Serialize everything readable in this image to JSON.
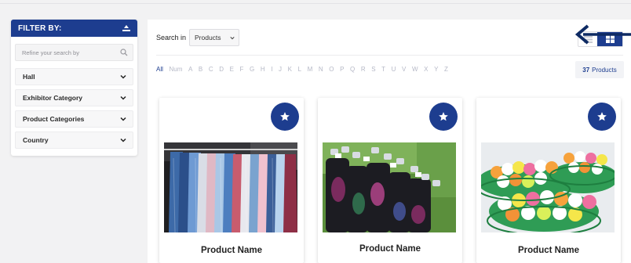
{
  "filter": {
    "title": "FILTER BY:",
    "search_placeholder": "Refine your search by",
    "dropdowns": [
      {
        "label": "Hall"
      },
      {
        "label": "Exhibitor Category"
      },
      {
        "label": "Product Categories"
      },
      {
        "label": "Country"
      }
    ]
  },
  "toolbar": {
    "search_in_label": "Search in",
    "search_in_value": "Products",
    "active_view": "grid"
  },
  "alphabet": {
    "items": [
      "All",
      "Num",
      "A",
      "B",
      "C",
      "D",
      "E",
      "F",
      "G",
      "H",
      "I",
      "J",
      "K",
      "L",
      "M",
      "N",
      "O",
      "P",
      "Q",
      "R",
      "S",
      "T",
      "U",
      "V",
      "W",
      "X",
      "Y",
      "Z"
    ],
    "active": "All"
  },
  "results": {
    "count": "37",
    "label": "Products"
  },
  "products": [
    {
      "name": "Product  Name",
      "image": "clothing-rack-photo"
    },
    {
      "name": "Product  Name",
      "image": "golf-bags-photo"
    },
    {
      "name": "Product  Name",
      "image": "golf-balls-baskets-photo"
    }
  ],
  "colors": {
    "brand": "#1d3d8f",
    "arrow": "#0e2a63",
    "letter_inactive": "#b5b8c6"
  }
}
